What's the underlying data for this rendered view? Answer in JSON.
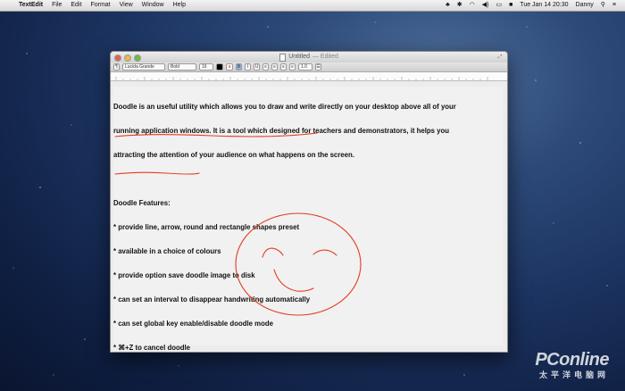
{
  "menubar": {
    "app_name": "TextEdit",
    "items": [
      "File",
      "Edit",
      "Format",
      "View",
      "Window",
      "Help"
    ],
    "clock": "Tue Jan 14  20:30",
    "user": "Danny"
  },
  "window": {
    "title": "Untitled",
    "title_suffix": "— Edited"
  },
  "toolbar": {
    "font_family": "Lucida Grande",
    "font_style": "Bold",
    "font_size": "16",
    "line_spacing": "1.0"
  },
  "document": {
    "lines": [
      "Doodle is an useful utility which allows you to draw and write directly on your desktop above all of your",
      "running application windows. It is a tool which designed for teachers and demonstrators, it helps you",
      "attracting the attention of your audience on what happens on the screen.",
      "",
      "Doodle Features:",
      "* provide line, arrow, round and rectangle shapes preset",
      "* available in a choice of colours",
      "* provide option save doodle image to disk",
      "* can set an interval to disappear handwriting automatically",
      "* can set global key enable/disable doodle mode",
      "* ⌘+Z to cancel doodle"
    ]
  },
  "watermark": {
    "brand": "PConline",
    "cn": "太平洋电脑网"
  },
  "colors": {
    "doodle": "#e23b1e",
    "desktop": "#1d3563"
  }
}
